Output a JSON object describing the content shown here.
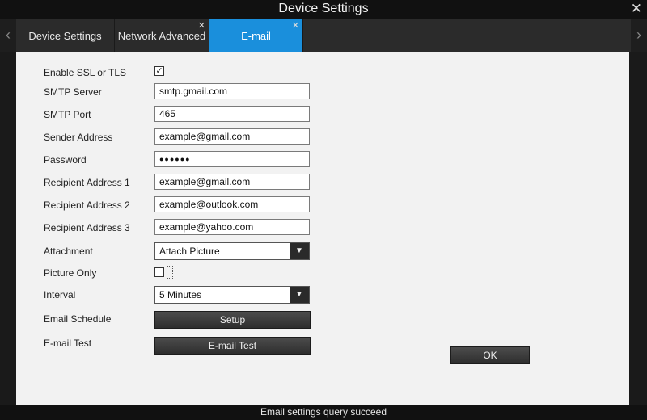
{
  "window": {
    "title": "Device Settings",
    "close_glyph": "✕"
  },
  "tabs": {
    "nav_left_glyph": "‹",
    "nav_right_glyph": "›",
    "items": [
      {
        "label": "Device Settings"
      },
      {
        "label": "Network Advanced",
        "close_glyph": "✕"
      },
      {
        "label": "E-mail",
        "close_glyph": "✕",
        "active": true
      }
    ]
  },
  "form": {
    "ssl": {
      "label": "Enable SSL or TLS",
      "checked": true,
      "check_glyph": "✓"
    },
    "smtp_server": {
      "label": "SMTP Server",
      "value": "smtp.gmail.com"
    },
    "smtp_port": {
      "label": "SMTP Port",
      "value": "465"
    },
    "sender": {
      "label": "Sender Address",
      "value": "example@gmail.com"
    },
    "password": {
      "label": "Password",
      "value": "●●●●●●"
    },
    "recipient1": {
      "label": "Recipient Address 1",
      "value": "example@gmail.com"
    },
    "recipient2": {
      "label": "Recipient Address 2",
      "value": "example@outlook.com"
    },
    "recipient3": {
      "label": "Recipient Address 3",
      "value": "example@yahoo.com"
    },
    "attachment": {
      "label": "Attachment",
      "value": "Attach Picture",
      "arrow_glyph": "▼"
    },
    "picture_only": {
      "label": "Picture Only",
      "checked": false
    },
    "interval": {
      "label": "Interval",
      "value": "5 Minutes",
      "arrow_glyph": "▼"
    },
    "schedule": {
      "label": "Email Schedule",
      "button": "Setup"
    },
    "test": {
      "label": "E-mail Test",
      "button": "E-mail Test"
    }
  },
  "ok_button": "OK",
  "status": "Email settings query succeed",
  "colors": {
    "active_tab": "#1a8fdc",
    "content_bg": "#f2f2f2",
    "chrome": "#111111"
  }
}
